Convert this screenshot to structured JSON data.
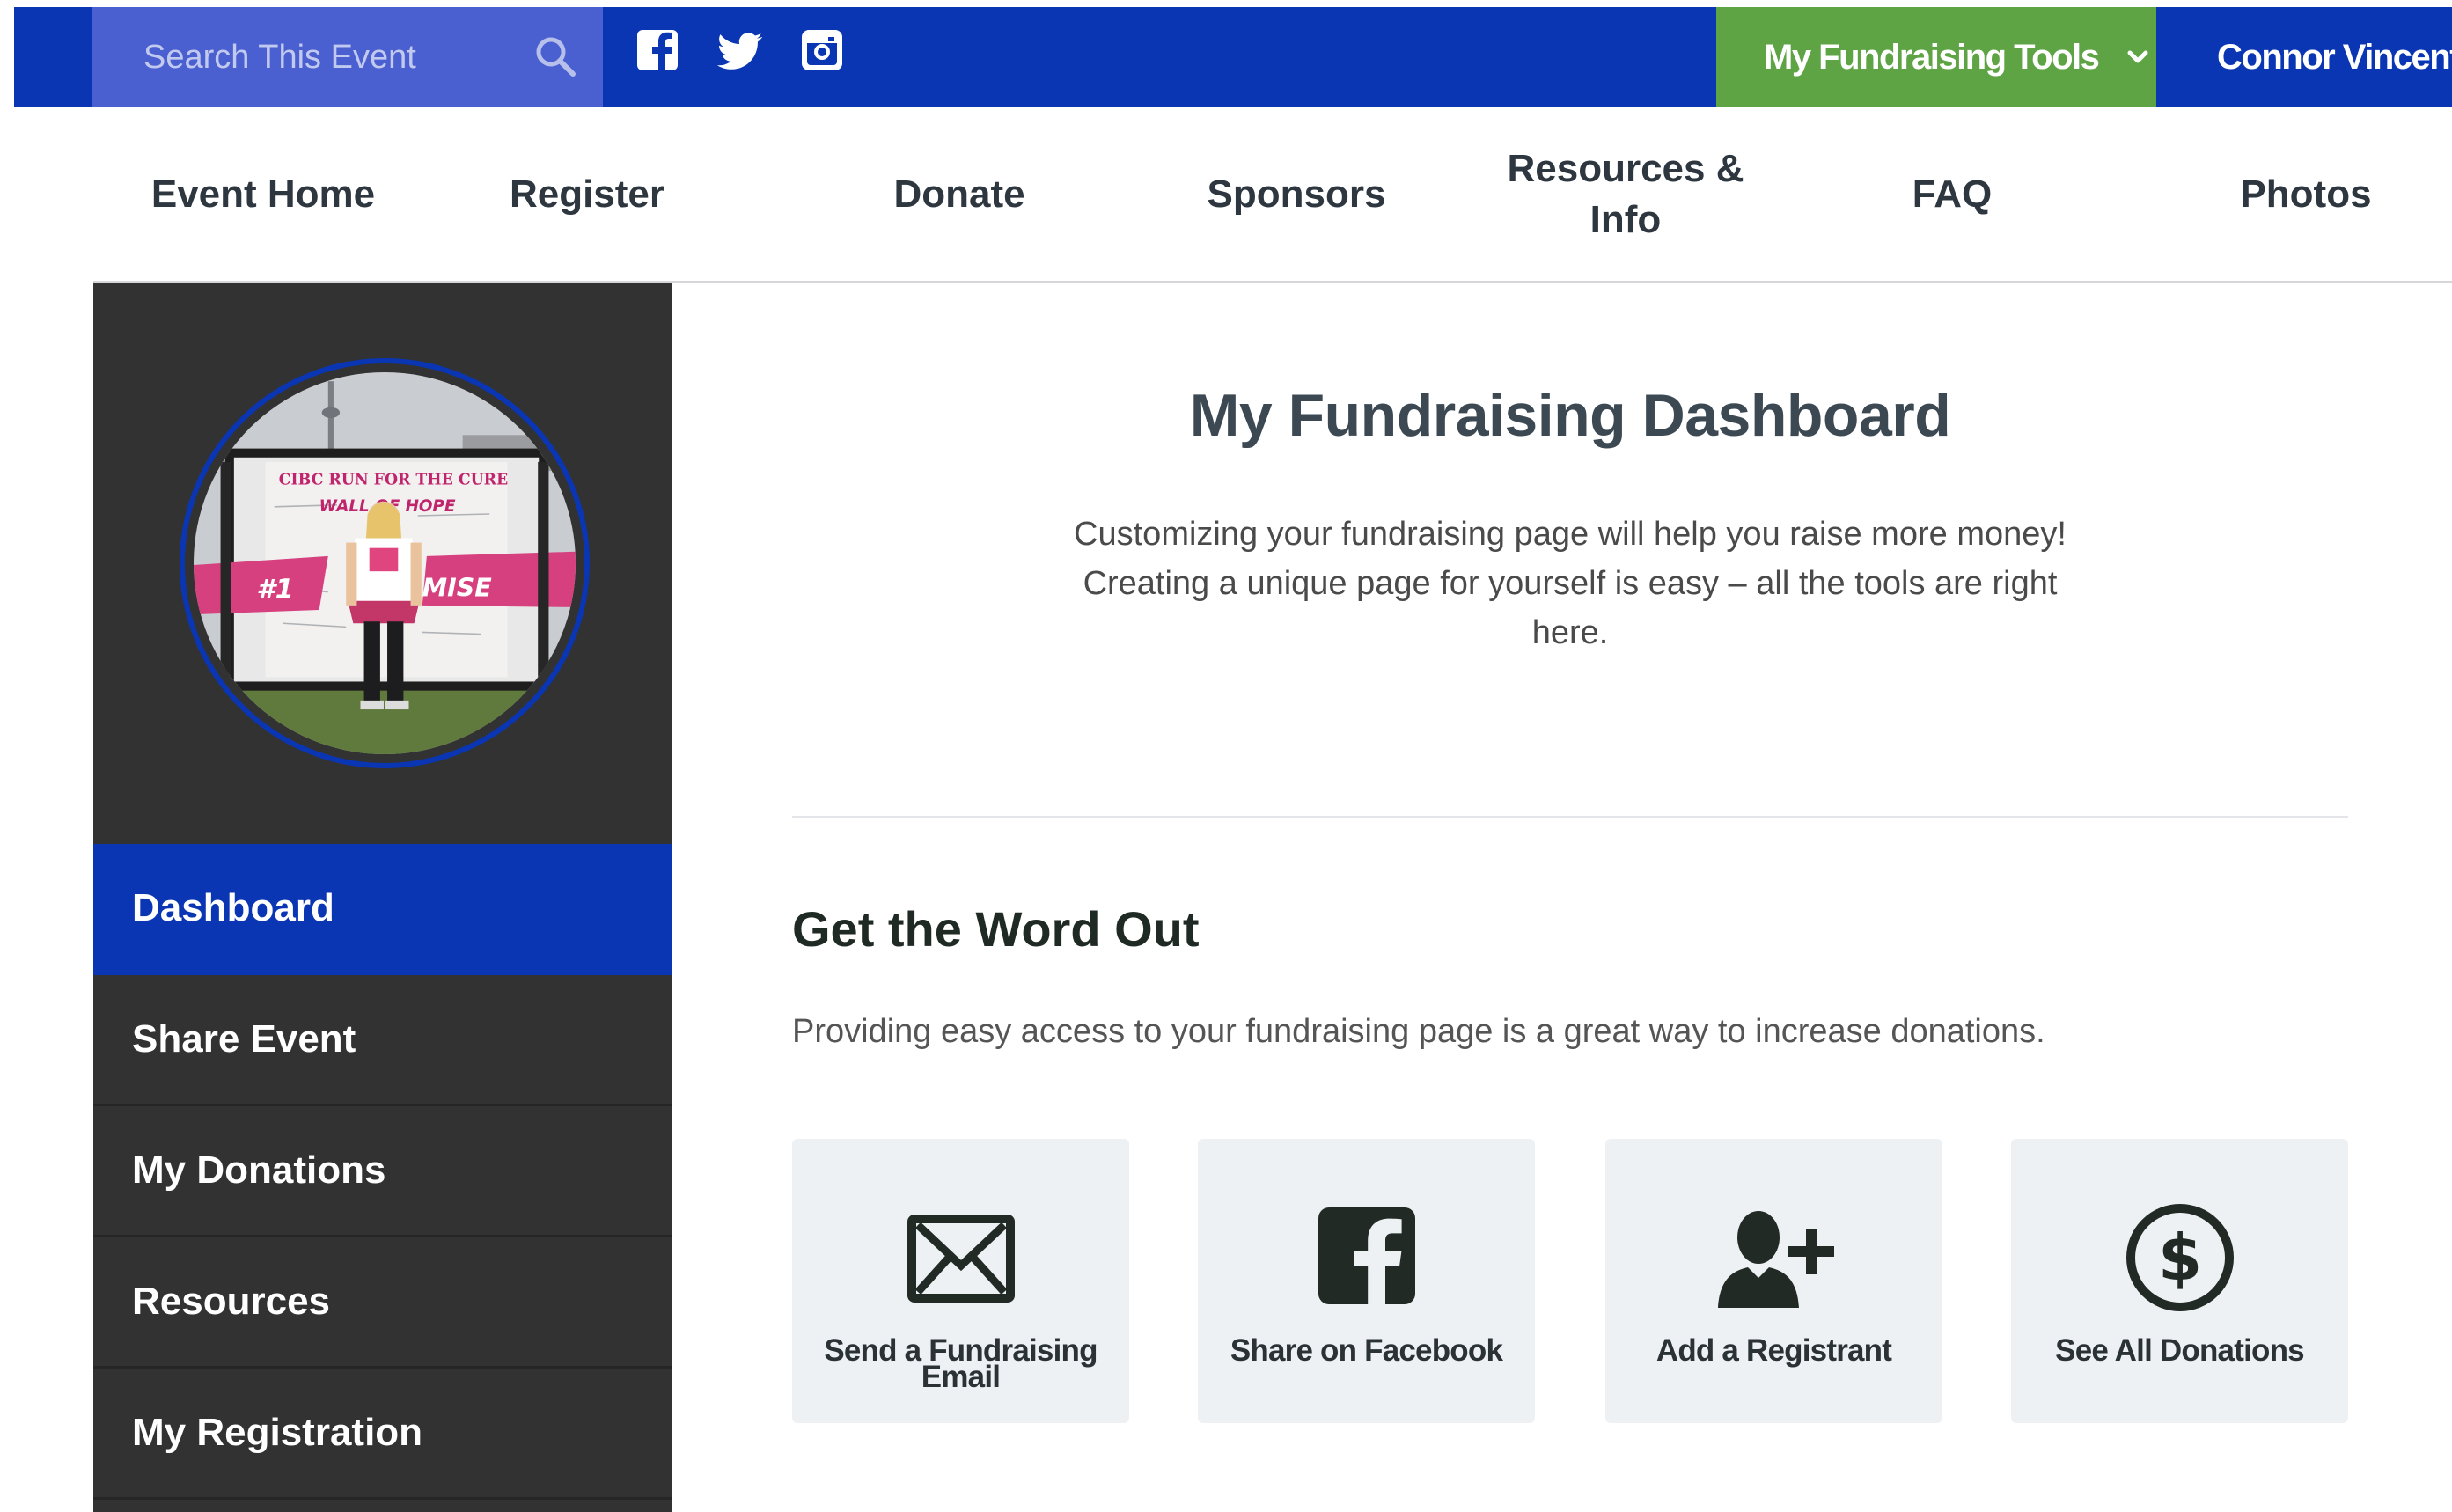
{
  "topbar": {
    "search_placeholder": "Search This Event",
    "search_icon": "magnifier",
    "social_icons": [
      "facebook",
      "twitter",
      "instagram"
    ],
    "tools_label": "My Fundraising Tools",
    "user_name": "Connor Vincent",
    "colors": {
      "bar": "#0a36b4",
      "search": "#4a5fd0",
      "tools": "#5ea344"
    }
  },
  "nav": {
    "items": [
      "Event Home",
      "Register",
      "Donate",
      "Sponsors",
      "Resources &\nInfo",
      "FAQ",
      "Photos"
    ]
  },
  "sidebar": {
    "avatar_alt": "Participant photo",
    "photo_sign": "CIBC RUN FOR THE CURE",
    "photo_banner": "WALL OF HOPE",
    "photo_hashtag_left": "#1",
    "photo_hashtag_right": "MISE",
    "items": [
      {
        "label": "Dashboard",
        "active": true
      },
      {
        "label": "Share Event",
        "active": false
      },
      {
        "label": "My Donations",
        "active": false
      },
      {
        "label": "Resources",
        "active": false
      },
      {
        "label": "My Registration",
        "active": false
      }
    ],
    "colors": {
      "background": "#323232",
      "active": "#0a36b4"
    }
  },
  "main": {
    "title": "My Fundraising Dashboard",
    "intro": "Customizing your fundraising page will help you raise more money! Creating a unique page for yourself is easy – all the tools are right here.",
    "section_title": "Get the Word Out",
    "section_desc": "Providing easy access to your fundraising page is a great way to increase donations.",
    "tiles": [
      {
        "label": "Send a Fundraising Email",
        "icon": "envelope-icon"
      },
      {
        "label": "Share on Facebook",
        "icon": "facebook-icon"
      },
      {
        "label": "Add a Registrant",
        "icon": "add-user-icon"
      },
      {
        "label": "See All Donations",
        "icon": "dollar-circle-icon"
      }
    ]
  }
}
